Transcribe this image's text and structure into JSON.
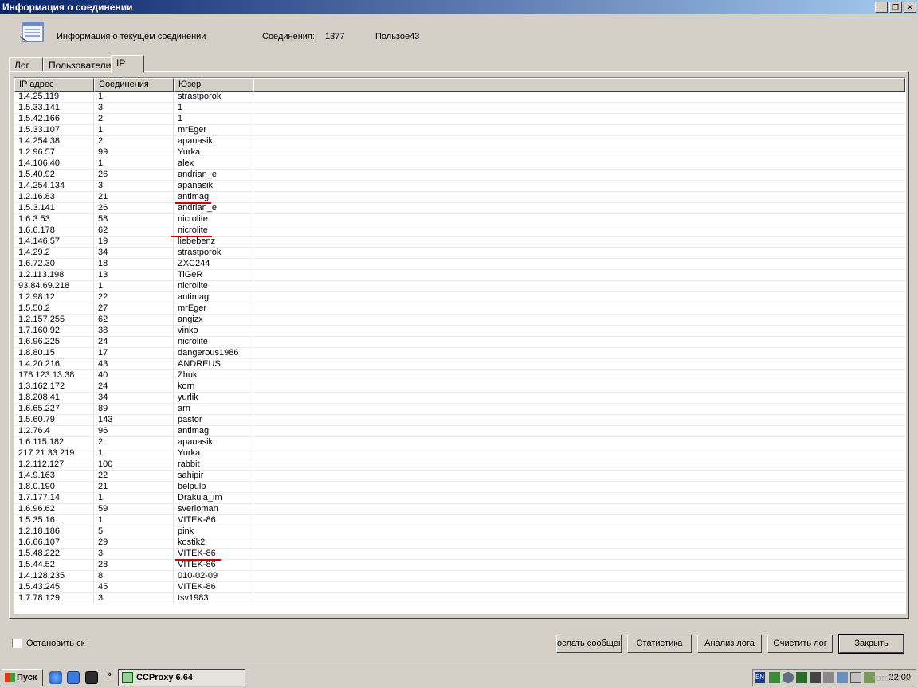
{
  "window": {
    "title": "Информация о соединении",
    "btn_min": "_",
    "btn_restore": "❐",
    "btn_close": "✕"
  },
  "info": {
    "label": "Информация о текущем соединении",
    "connections_label": "Соединения:",
    "connections_value": "1377",
    "users_text": "Пользое43"
  },
  "tabs": [
    {
      "label": "Лог",
      "active": false
    },
    {
      "label": "Пользователи",
      "active": false
    },
    {
      "label": "IP",
      "active": true
    }
  ],
  "table": {
    "columns": [
      "IP адрес",
      "Соединения",
      "Юзер"
    ],
    "rows": [
      [
        "1.4.25.119",
        "1",
        "strastporok"
      ],
      [
        "1.5.33.141",
        "3",
        "1"
      ],
      [
        "1.5.42.166",
        "2",
        "1"
      ],
      [
        "1.5.33.107",
        "1",
        "mrEger"
      ],
      [
        "1.4.254.38",
        "2",
        "apanasik"
      ],
      [
        "1.2.96.57",
        "99",
        "Yurka"
      ],
      [
        "1.4.106.40",
        "1",
        "alex"
      ],
      [
        "1.5.40.92",
        "26",
        "andrian_e"
      ],
      [
        "1.4.254.134",
        "3",
        "apanasik"
      ],
      [
        "1.2.16.83",
        "21",
        "antimag"
      ],
      [
        "1.5.3.141",
        "26",
        "andrian_e"
      ],
      [
        "1.6.3.53",
        "58",
        "nicrolite"
      ],
      [
        "1.6.6.178",
        "62",
        "nicrolite"
      ],
      [
        "1.4.146.57",
        "19",
        "liebebenz"
      ],
      [
        "1.4.29.2",
        "34",
        "strastporok"
      ],
      [
        "1.6.72.30",
        "18",
        "ZXC244"
      ],
      [
        "1.2.113.198",
        "13",
        "TiGeR"
      ],
      [
        "93.84.69.218",
        "1",
        "nicrolite"
      ],
      [
        "1.2.98.12",
        "22",
        "antimag"
      ],
      [
        "1.5.50.2",
        "27",
        "mrEger"
      ],
      [
        "1.2.157.255",
        "62",
        "angizx"
      ],
      [
        "1.7.160.92",
        "38",
        "vinko"
      ],
      [
        "1.6.96.225",
        "24",
        "nicrolite"
      ],
      [
        "1.8.80.15",
        "17",
        "dangerous1986"
      ],
      [
        "1.4.20.216",
        "43",
        "ANDREUS"
      ],
      [
        "178.123.13.38",
        "40",
        "Zhuk"
      ],
      [
        "1.3.162.172",
        "24",
        "korn"
      ],
      [
        "1.8.208.41",
        "34",
        "yurlik"
      ],
      [
        "1.6.65.227",
        "89",
        "arn"
      ],
      [
        "1.5.60.79",
        "143",
        "pastor"
      ],
      [
        "1.2.76.4",
        "96",
        "antimag"
      ],
      [
        "1.6.115.182",
        "2",
        "apanasik"
      ],
      [
        "217.21.33.219",
        "1",
        "Yurka"
      ],
      [
        "1.2.112.127",
        "100",
        "rabbit"
      ],
      [
        "1.4.9.163",
        "22",
        "sahipir"
      ],
      [
        "1.8.0.190",
        "21",
        "belpulp"
      ],
      [
        "1.7.177.14",
        "1",
        "Drakula_im"
      ],
      [
        "1.6.96.62",
        "59",
        "sverloman"
      ],
      [
        "1.5.35.16",
        "1",
        "VITEK-86"
      ],
      [
        "1.2.18.186",
        "5",
        "pink"
      ],
      [
        "1.6.66.107",
        "29",
        "kostik2"
      ],
      [
        "1.5.48.222",
        "3",
        "VITEK-86"
      ],
      [
        "1.5.44.52",
        "28",
        "VITEK-86"
      ],
      [
        "1.4.128.235",
        "8",
        "010-02-09"
      ],
      [
        "1.5.43.245",
        "45",
        "VITEK-86"
      ],
      [
        "1.7.78.129",
        "3",
        "tsv1983"
      ]
    ]
  },
  "bottom": {
    "checkbox_label": "Остановить ск",
    "buttons": [
      "ослать сообщен",
      "Статистика",
      "Анализ лога",
      "Очистить лог",
      "Закрыть"
    ]
  },
  "taskbar": {
    "start_label": "Пуск",
    "chevron": "»",
    "task_label": "CCProxy 6.64",
    "lang": "EN",
    "clock": "22:00",
    "watermark": "FOTOFAZ.BY"
  },
  "colors": {
    "face": "#d4d0c8",
    "title_start": "#0a246a",
    "title_end": "#a6caf0",
    "annotation": "#d00000"
  }
}
